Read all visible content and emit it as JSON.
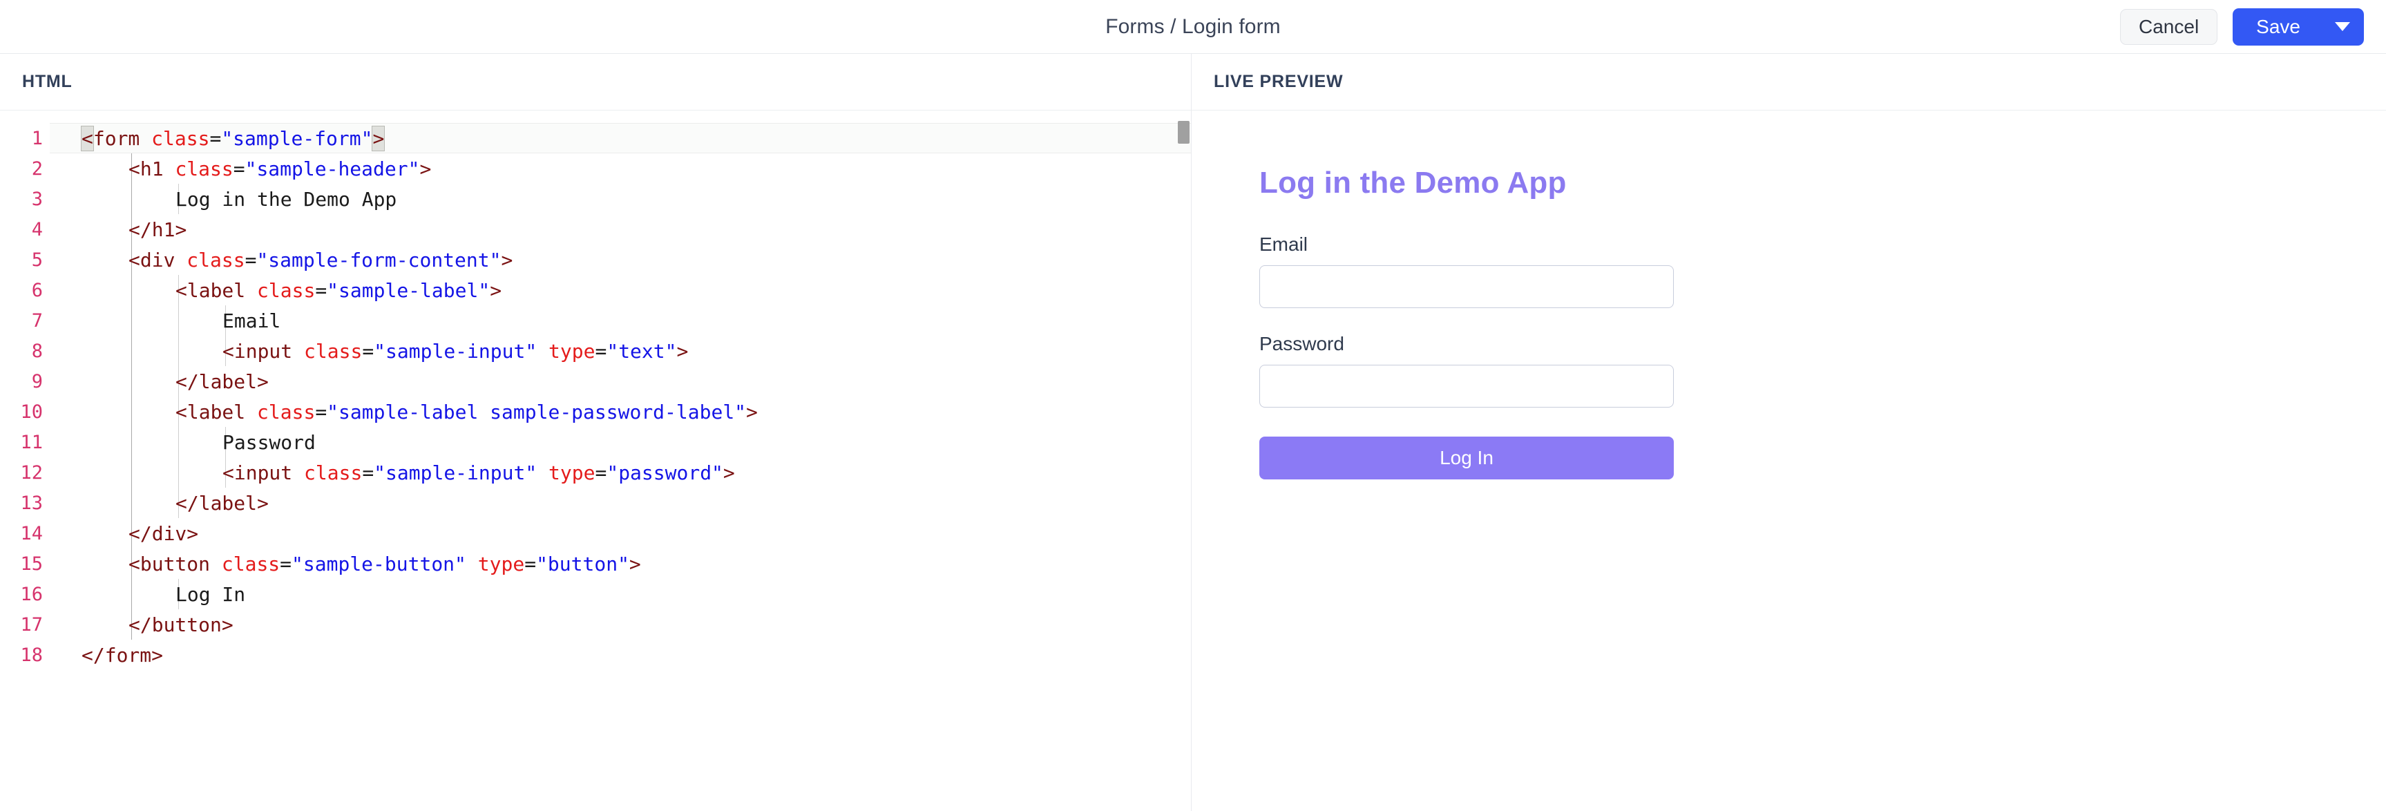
{
  "topbar": {
    "breadcrumb": "Forms / Login form",
    "cancel_label": "Cancel",
    "save_label": "Save",
    "save_caret_icon": "chevron-down-icon",
    "accent_blue": "#3358f4",
    "cancel_bg": "#f6f7f8"
  },
  "editor_panel": {
    "title": "HTML",
    "scroll_thumb_color": "#a0a0a0",
    "line_number_color": "#d6336c",
    "active_line": 1,
    "lines": [
      {
        "n": "1",
        "indent": 0,
        "tokens": [
          {
            "t": "punct",
            "v": "<",
            "hl": true
          },
          {
            "t": "tag",
            "v": "form"
          },
          {
            "t": "text",
            "v": " "
          },
          {
            "t": "attr",
            "v": "class"
          },
          {
            "t": "eq",
            "v": "="
          },
          {
            "t": "str",
            "v": "\"sample-form\""
          },
          {
            "t": "punct",
            "v": ">",
            "hl": true
          }
        ]
      },
      {
        "n": "2",
        "indent": 1,
        "tokens": [
          {
            "t": "punct",
            "v": "<"
          },
          {
            "t": "tag",
            "v": "h1"
          },
          {
            "t": "text",
            "v": " "
          },
          {
            "t": "attr",
            "v": "class"
          },
          {
            "t": "eq",
            "v": "="
          },
          {
            "t": "str",
            "v": "\"sample-header\""
          },
          {
            "t": "punct",
            "v": ">"
          }
        ]
      },
      {
        "n": "3",
        "indent": 2,
        "tokens": [
          {
            "t": "text",
            "v": "Log in the Demo App"
          }
        ]
      },
      {
        "n": "4",
        "indent": 1,
        "tokens": [
          {
            "t": "punct",
            "v": "</"
          },
          {
            "t": "tag",
            "v": "h1"
          },
          {
            "t": "punct",
            "v": ">"
          }
        ]
      },
      {
        "n": "5",
        "indent": 1,
        "tokens": [
          {
            "t": "punct",
            "v": "<"
          },
          {
            "t": "tag",
            "v": "div"
          },
          {
            "t": "text",
            "v": " "
          },
          {
            "t": "attr",
            "v": "class"
          },
          {
            "t": "eq",
            "v": "="
          },
          {
            "t": "str",
            "v": "\"sample-form-content\""
          },
          {
            "t": "punct",
            "v": ">"
          }
        ]
      },
      {
        "n": "6",
        "indent": 2,
        "tokens": [
          {
            "t": "punct",
            "v": "<"
          },
          {
            "t": "tag",
            "v": "label"
          },
          {
            "t": "text",
            "v": " "
          },
          {
            "t": "attr",
            "v": "class"
          },
          {
            "t": "eq",
            "v": "="
          },
          {
            "t": "str",
            "v": "\"sample-label\""
          },
          {
            "t": "punct",
            "v": ">"
          }
        ]
      },
      {
        "n": "7",
        "indent": 3,
        "tokens": [
          {
            "t": "text",
            "v": "Email"
          }
        ]
      },
      {
        "n": "8",
        "indent": 3,
        "tokens": [
          {
            "t": "punct",
            "v": "<"
          },
          {
            "t": "tag",
            "v": "input"
          },
          {
            "t": "text",
            "v": " "
          },
          {
            "t": "attr",
            "v": "class"
          },
          {
            "t": "eq",
            "v": "="
          },
          {
            "t": "str",
            "v": "\"sample-input\""
          },
          {
            "t": "text",
            "v": " "
          },
          {
            "t": "attr",
            "v": "type"
          },
          {
            "t": "eq",
            "v": "="
          },
          {
            "t": "str",
            "v": "\"text\""
          },
          {
            "t": "punct",
            "v": ">"
          }
        ]
      },
      {
        "n": "9",
        "indent": 2,
        "tokens": [
          {
            "t": "punct",
            "v": "</"
          },
          {
            "t": "tag",
            "v": "label"
          },
          {
            "t": "punct",
            "v": ">"
          }
        ]
      },
      {
        "n": "10",
        "indent": 2,
        "tokens": [
          {
            "t": "punct",
            "v": "<"
          },
          {
            "t": "tag",
            "v": "label"
          },
          {
            "t": "text",
            "v": " "
          },
          {
            "t": "attr",
            "v": "class"
          },
          {
            "t": "eq",
            "v": "="
          },
          {
            "t": "str",
            "v": "\"sample-label sample-password-label\""
          },
          {
            "t": "punct",
            "v": ">"
          }
        ]
      },
      {
        "n": "11",
        "indent": 3,
        "tokens": [
          {
            "t": "text",
            "v": "Password"
          }
        ]
      },
      {
        "n": "12",
        "indent": 3,
        "tokens": [
          {
            "t": "punct",
            "v": "<"
          },
          {
            "t": "tag",
            "v": "input"
          },
          {
            "t": "text",
            "v": " "
          },
          {
            "t": "attr",
            "v": "class"
          },
          {
            "t": "eq",
            "v": "="
          },
          {
            "t": "str",
            "v": "\"sample-input\""
          },
          {
            "t": "text",
            "v": " "
          },
          {
            "t": "attr",
            "v": "type"
          },
          {
            "t": "eq",
            "v": "="
          },
          {
            "t": "str",
            "v": "\"password\""
          },
          {
            "t": "punct",
            "v": ">"
          }
        ]
      },
      {
        "n": "13",
        "indent": 2,
        "tokens": [
          {
            "t": "punct",
            "v": "</"
          },
          {
            "t": "tag",
            "v": "label"
          },
          {
            "t": "punct",
            "v": ">"
          }
        ]
      },
      {
        "n": "14",
        "indent": 1,
        "tokens": [
          {
            "t": "punct",
            "v": "</"
          },
          {
            "t": "tag",
            "v": "div"
          },
          {
            "t": "punct",
            "v": ">"
          }
        ]
      },
      {
        "n": "15",
        "indent": 1,
        "tokens": [
          {
            "t": "punct",
            "v": "<"
          },
          {
            "t": "tag",
            "v": "button"
          },
          {
            "t": "text",
            "v": " "
          },
          {
            "t": "attr",
            "v": "class"
          },
          {
            "t": "eq",
            "v": "="
          },
          {
            "t": "str",
            "v": "\"sample-button\""
          },
          {
            "t": "text",
            "v": " "
          },
          {
            "t": "attr",
            "v": "type"
          },
          {
            "t": "eq",
            "v": "="
          },
          {
            "t": "str",
            "v": "\"button\""
          },
          {
            "t": "punct",
            "v": ">"
          }
        ]
      },
      {
        "n": "16",
        "indent": 2,
        "tokens": [
          {
            "t": "text",
            "v": "Log In"
          }
        ]
      },
      {
        "n": "17",
        "indent": 1,
        "tokens": [
          {
            "t": "punct",
            "v": "</"
          },
          {
            "t": "tag",
            "v": "button"
          },
          {
            "t": "punct",
            "v": ">"
          }
        ]
      },
      {
        "n": "18",
        "indent": 0,
        "tokens": [
          {
            "t": "punct",
            "v": "</"
          },
          {
            "t": "tag",
            "v": "form"
          },
          {
            "t": "punct",
            "v": ">"
          }
        ]
      }
    ]
  },
  "preview_panel": {
    "title": "LIVE PREVIEW",
    "form": {
      "heading": "Log in the Demo App",
      "heading_color": "#8b7af0",
      "email_label": "Email",
      "email_value": "",
      "email_placeholder": "",
      "password_label": "Password",
      "password_value": "",
      "password_placeholder": "",
      "submit_label": "Log In",
      "submit_color": "#8b7af5"
    }
  }
}
